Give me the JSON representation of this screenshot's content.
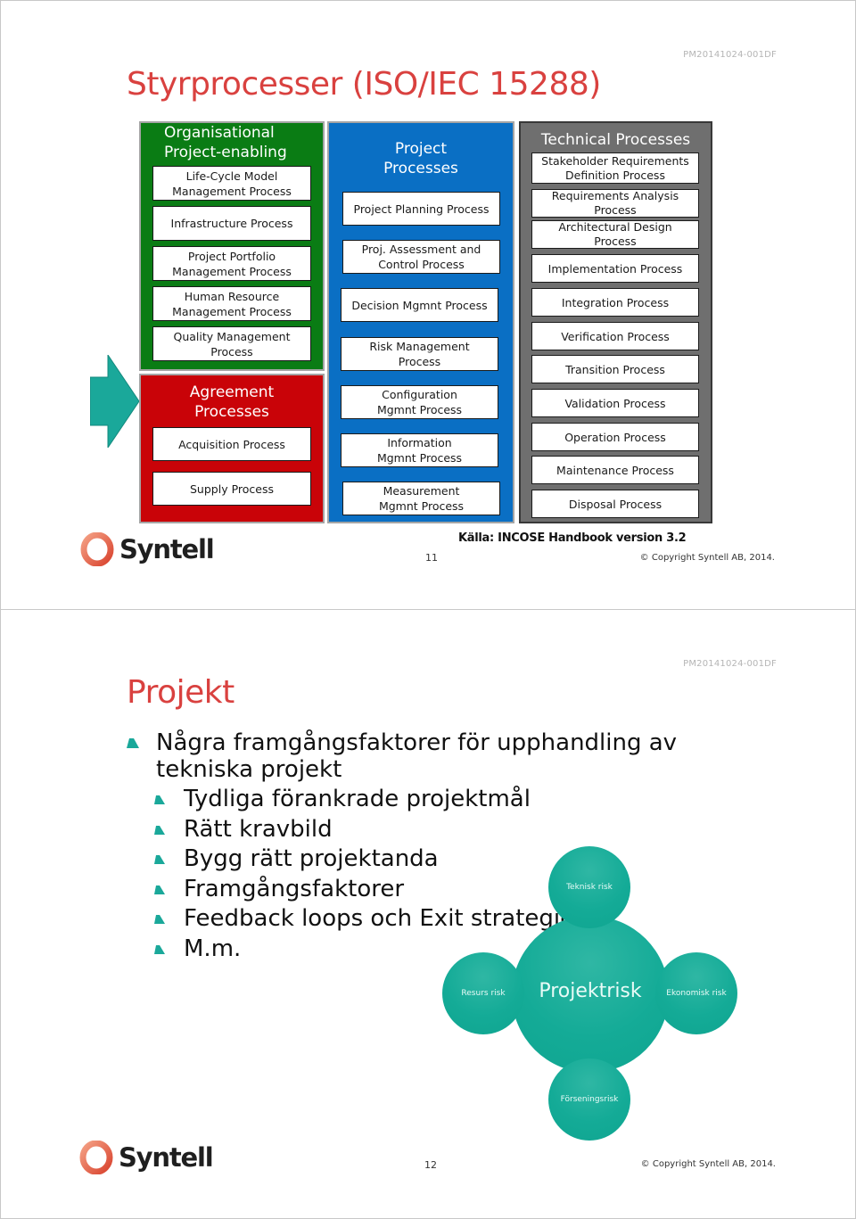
{
  "slides": [
    {
      "doc_id": "PM20141024-001DF",
      "title": "Styrprocesser (ISO/IEC 15288)",
      "diagram": {
        "organisational": {
          "title": "Organisational\nProject-enabling",
          "items": [
            "Life-Cycle Model\nManagement Process",
            "Infrastructure Process",
            "Project Portfolio\nManagement Process",
            "Human Resource\nManagement Process",
            "Quality Management\nProcess"
          ]
        },
        "agreement": {
          "title": "Agreement\nProcesses",
          "items": [
            "Acquisition Process",
            "Supply Process"
          ]
        },
        "project": {
          "title": "Project\nProcesses",
          "items": [
            "Project Planning Process",
            "Proj. Assessment and\nControl Process",
            "Decision Mgmnt Process",
            "Risk Management\nProcess",
            "Configuration\nMgmnt Process",
            "Information\nMgmnt Process",
            "Measurement\nMgmnt Process"
          ]
        },
        "technical": {
          "title": "Technical Processes",
          "items": [
            "Stakeholder Requirements\nDefinition Process",
            "Requirements Analysis\nProcess",
            "Architectural Design\nProcess",
            "Implementation Process",
            "Integration Process",
            "Verification Process",
            "Transition Process",
            "Validation Process",
            "Operation Process",
            "Maintenance Process",
            "Disposal Process"
          ]
        },
        "colors": {
          "organisational": "#0a7c14",
          "agreement": "#c90308",
          "project": "#0a6fc4",
          "technical": "#6f6f6f",
          "arrow": "#1aa89a"
        }
      },
      "source": "Källa: INCOSE Handbook version 3.2",
      "logo_text": "Syntell",
      "page_number": "11",
      "copyright": "© Copyright Syntell AB, 2014."
    },
    {
      "doc_id": "PM20141024-001DF",
      "title": "Projekt",
      "bullet_main": "Några framgångsfaktorer för upphandling av tekniska projekt",
      "bullets_sub": [
        "Tydliga förankrade projektmål",
        "Rätt kravbild",
        "Bygg rätt projektanda",
        "Framgångsfaktorer",
        "Feedback loops och Exit strategier",
        "M.m."
      ],
      "risk_diagram": {
        "center": "Projektrisk",
        "top": "Teknisk risk",
        "left": "Resurs risk",
        "right": "Ekonomisk risk",
        "bottom": "Förseningsrisk",
        "color": "#14ab97"
      },
      "logo_text": "Syntell",
      "page_number": "12",
      "copyright": "© Copyright Syntell AB, 2014."
    }
  ]
}
